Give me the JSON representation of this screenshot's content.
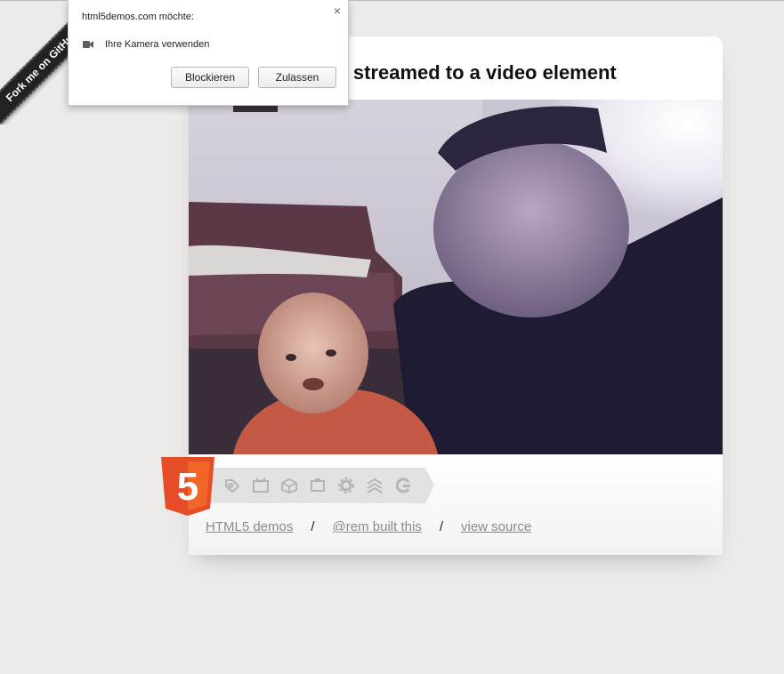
{
  "ribbon": {
    "label": "Fork me on GitHub"
  },
  "page": {
    "title": "Video streamed to a video element"
  },
  "footer": {
    "links": [
      {
        "label": "HTML5 demos"
      },
      {
        "label": "@rem built this"
      },
      {
        "label": "view source"
      }
    ],
    "separator": "/",
    "badge_glyph": "5"
  },
  "permission_popup": {
    "origin": "html5demos.com möchte:",
    "permission": "Ihre Kamera verwenden",
    "close_glyph": "×",
    "block_label": "Blockieren",
    "allow_label": "Zulassen"
  },
  "tech_icons": [
    "semantics-icon",
    "multimedia-icon",
    "3d-icon",
    "device-access-icon",
    "performance-icon",
    "css3-icon",
    "connectivity-icon"
  ],
  "colors": {
    "background": "#ecebe9",
    "html5_orange": "#e44d26",
    "link_gray": "#8a8a8a"
  }
}
